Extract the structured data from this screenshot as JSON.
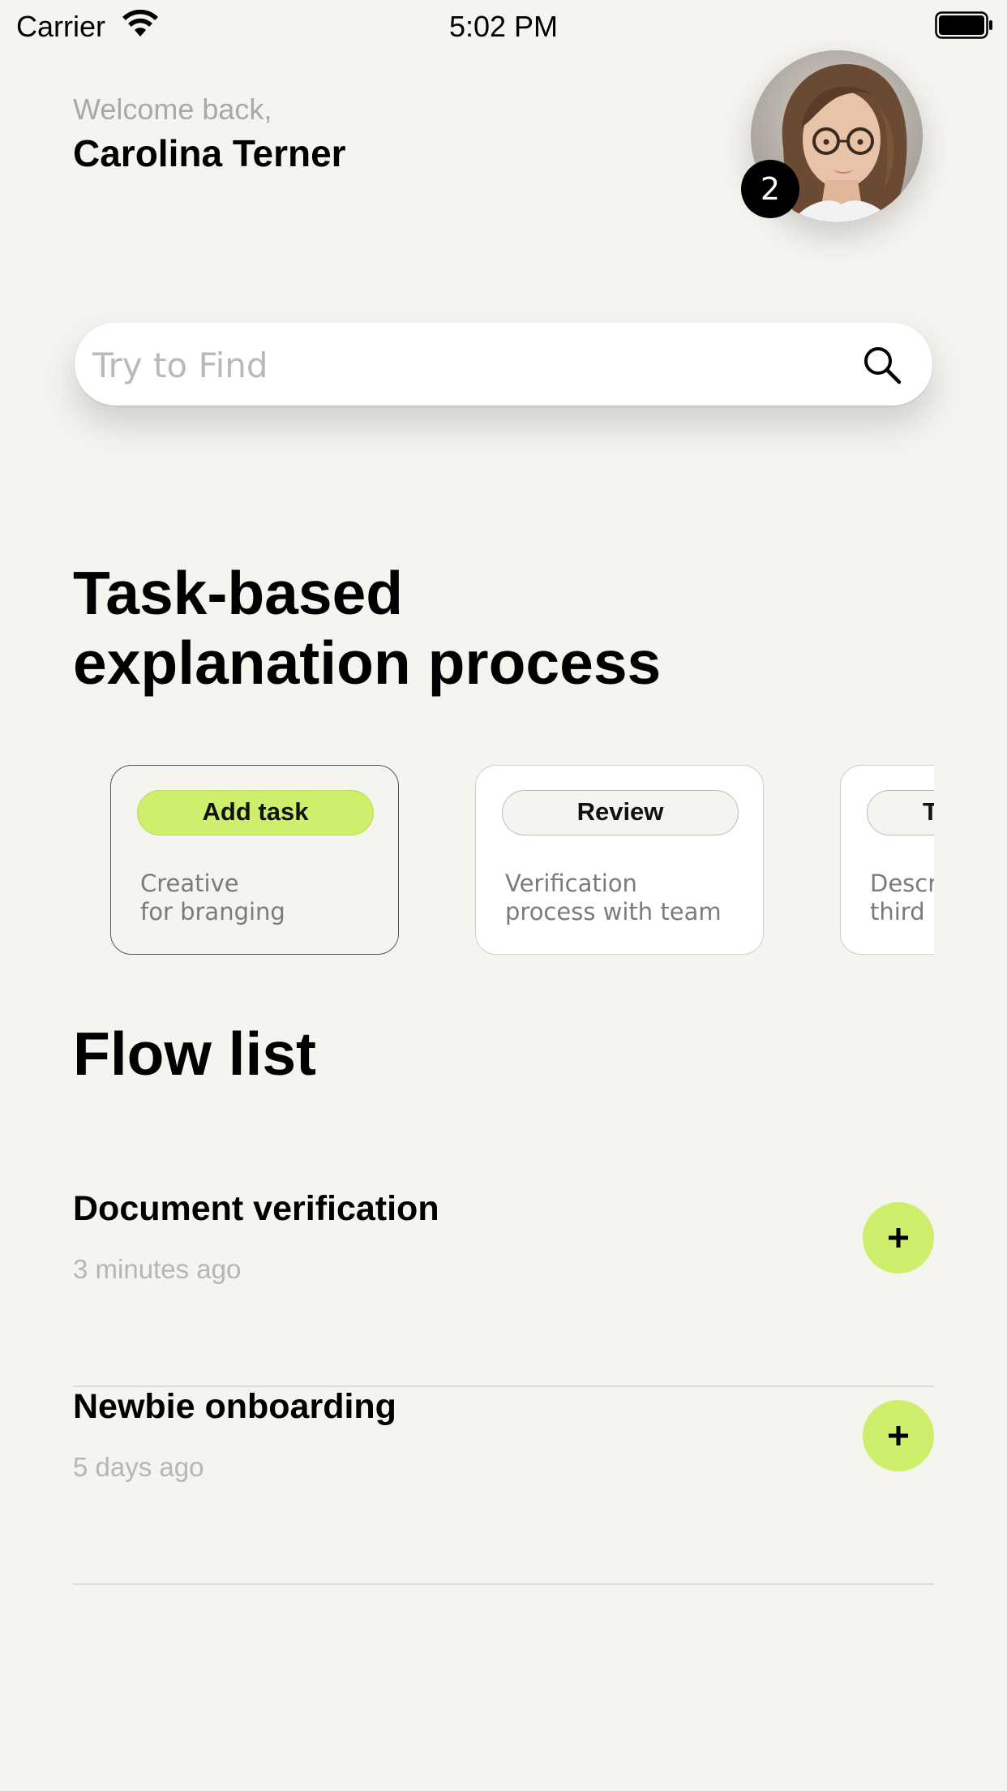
{
  "status_bar": {
    "carrier": "Carrier",
    "time": "5:02 PM"
  },
  "header": {
    "welcome": "Welcome back,",
    "user_name": "Carolina Terner",
    "notification_count": "2"
  },
  "search": {
    "placeholder": "Try to Find",
    "icon": "search-icon"
  },
  "section": {
    "title_line1": "Task-based",
    "title_line2": "explanation process"
  },
  "cards": [
    {
      "chip": "Add task",
      "description": "Creative\nfor branging",
      "active": true
    },
    {
      "chip": "Review",
      "description": "Verification\nprocess with team",
      "active": false
    },
    {
      "chip": "T",
      "description": "Descr\nthird",
      "active": false
    }
  ],
  "flow_list": {
    "title": "Flow list",
    "items": [
      {
        "title": "Document verification",
        "time": "3 minutes ago",
        "action_icon": "plus-icon"
      },
      {
        "title": "Newbie onboarding",
        "time": "5 days ago",
        "action_icon": "plus-icon"
      }
    ]
  },
  "colors": {
    "background": "#f5f4ef",
    "accent_lime": "#cdef6b",
    "badge": "#000000"
  }
}
